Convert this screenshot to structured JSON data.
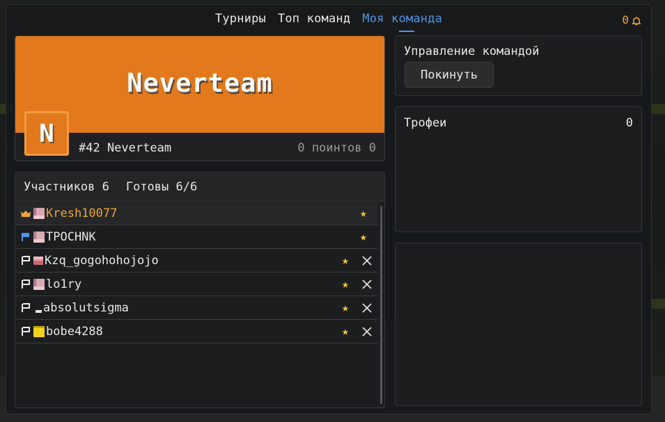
{
  "nav": {
    "tabs": [
      {
        "label": "Турниры",
        "active": false
      },
      {
        "label": "Топ команд",
        "active": false
      },
      {
        "label": "Моя команда",
        "active": true
      }
    ],
    "notifications_count": "0"
  },
  "team": {
    "name": "Neverteam",
    "avatar_letter": "N",
    "rank_line": "#42 Neverteam",
    "points_line": "0 поинтов 0",
    "banner_color": "#e2791c"
  },
  "members": {
    "count_label": "Участников 6",
    "ready_label": "Готовы 6/6",
    "list": [
      {
        "name": "Kresh10077",
        "role": "crown-icon",
        "head": "pink-head-icon",
        "starred": true,
        "kickable": false
      },
      {
        "name": "TPOCHNK",
        "role": "blue-flag-icon",
        "head": "pink-head-icon",
        "starred": true,
        "kickable": false
      },
      {
        "name": "Kzq_gogohohojojo",
        "role": "white-flag-icon",
        "head": "pig-head-icon",
        "starred": true,
        "kickable": true
      },
      {
        "name": "lo1ry",
        "role": "white-flag-icon",
        "head": "pink-head-icon",
        "starred": true,
        "kickable": true
      },
      {
        "name": "absolutsigma",
        "role": "white-flag-icon",
        "head": "dark-head-icon",
        "starred": true,
        "kickable": true
      },
      {
        "name": "bobe4288",
        "role": "white-flag-icon",
        "head": "yellow-head-icon",
        "starred": true,
        "kickable": true
      }
    ]
  },
  "management": {
    "title": "Управление командой",
    "leave_label": "Покинуть"
  },
  "trophies": {
    "title": "Трофеи",
    "count": "0"
  },
  "colors": {
    "accent_blue": "#4e95e8",
    "accent_orange": "#f2a531",
    "star_yellow": "#f2c330"
  }
}
